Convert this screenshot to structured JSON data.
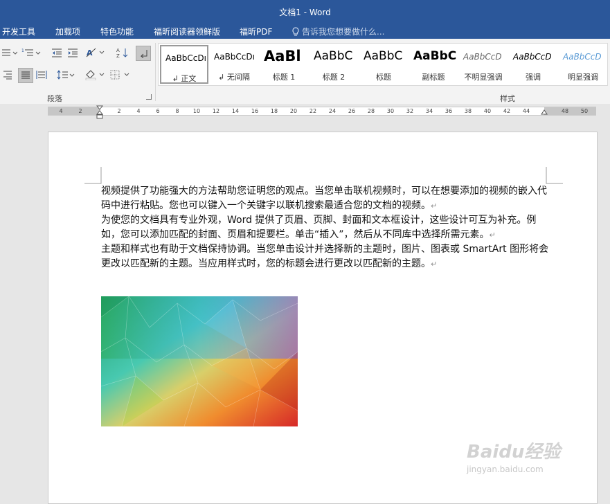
{
  "window": {
    "title": "文档1 - Word"
  },
  "menu_tabs": [
    "开发工具",
    "加载项",
    "特色功能",
    "福昕阅读器领鲜版",
    "福昕PDF"
  ],
  "tell_me": {
    "placeholder": "告诉我您想要做什么..."
  },
  "ribbon": {
    "paragraph_group_label": "段落",
    "styles_group_label": "样式",
    "styles": [
      {
        "sample": "AaBbCcDı",
        "name": "↲ 正文"
      },
      {
        "sample": "AaBbCcDı",
        "name": "↲ 无间隔"
      },
      {
        "sample": "AaBl",
        "name": "标题 1"
      },
      {
        "sample": "AaBbC",
        "name": "标题 2"
      },
      {
        "sample": "AaBbC",
        "name": "标题"
      },
      {
        "sample": "AaBbC",
        "name": "副标题"
      },
      {
        "sample": "AaBbCcD",
        "name": "不明显强调"
      },
      {
        "sample": "AaBbCcD",
        "name": "强调"
      },
      {
        "sample": "AaBbCcD",
        "name": "明显强调"
      }
    ]
  },
  "ruler": {
    "numbers": [
      "4",
      "2",
      "2",
      "4",
      "6",
      "8",
      "10",
      "12",
      "14",
      "16",
      "18",
      "20",
      "22",
      "24",
      "26",
      "28",
      "30",
      "32",
      "34",
      "36",
      "38",
      "40",
      "42",
      "44",
      "48",
      "50"
    ]
  },
  "document": {
    "paragraphs": [
      "视频提供了功能强大的方法帮助您证明您的观点。当您单击联机视频时，可以在想要添加的视频的嵌入代码中进行粘贴。您也可以键入一个关键字以联机搜索最适合您的文档的视频。",
      "为使您的文档具有专业外观，Word 提供了页眉、页脚、封面和文本框设计，这些设计可互为补充。例如，您可以添加匹配的封面、页眉和提要栏。单击“插入”，然后从不同库中选择所需元素。",
      "主题和样式也有助于文档保持协调。当您单击设计并选择新的主题时，图片、图表或 SmartArt 图形将会更改以匹配新的主题。当应用样式时，您的标题会进行更改以匹配新的主题。"
    ],
    "paragraph_mark": "↵"
  },
  "watermark": {
    "brand": "Baidu经验",
    "url": "jingyan.baidu.com"
  }
}
